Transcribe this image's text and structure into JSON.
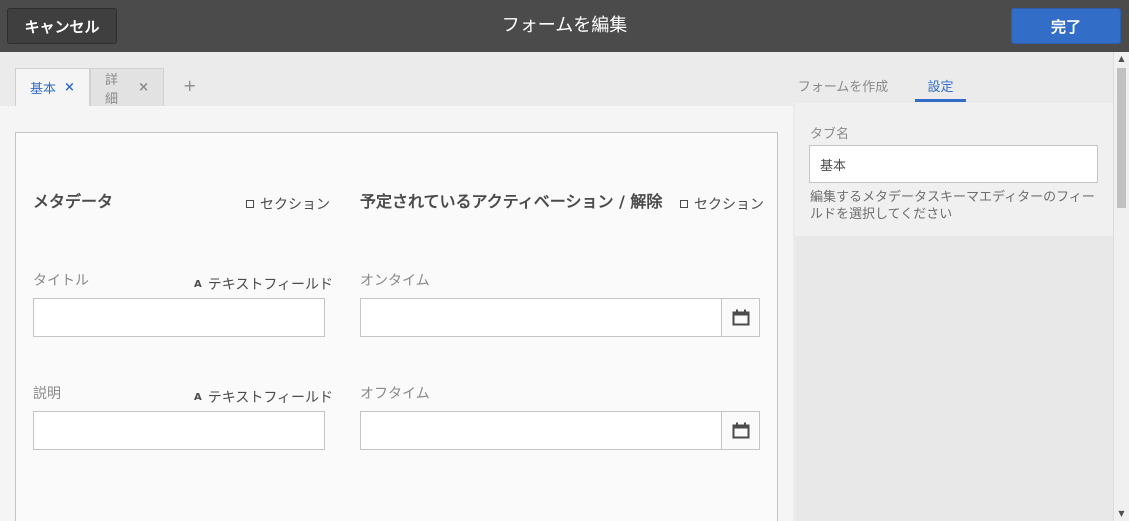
{
  "topbar": {
    "cancel_label": "キャンセル",
    "title": "フォームを編集",
    "done_label": "完了"
  },
  "tabs": [
    {
      "label": "基本",
      "close": "×"
    },
    {
      "label": "詳細",
      "close": "×"
    }
  ],
  "add_tab": "+",
  "form": {
    "left_section": {
      "heading": "メタデータ",
      "type_label": "セクション",
      "fields": [
        {
          "label": "タイトル",
          "type_label": "テキストフィールド",
          "type_icon": "A"
        },
        {
          "label": "説明",
          "type_label": "テキストフィールド",
          "type_icon": "A"
        }
      ]
    },
    "right_section": {
      "heading": "予定されているアクティベーション / 解除",
      "type_label": "セクション",
      "fields": [
        {
          "label": "オンタイム"
        },
        {
          "label": "オフタイム"
        }
      ]
    }
  },
  "rail": {
    "tabs": [
      "フォームを作成",
      "設定"
    ],
    "tab_name_label": "タブ名",
    "tab_name_value": "基本",
    "help_text": "編集するメタデータスキーマエディターのフィールドを選択してください"
  },
  "colors": {
    "accent": "#326ec8",
    "topbar": "#4b4b4b"
  }
}
